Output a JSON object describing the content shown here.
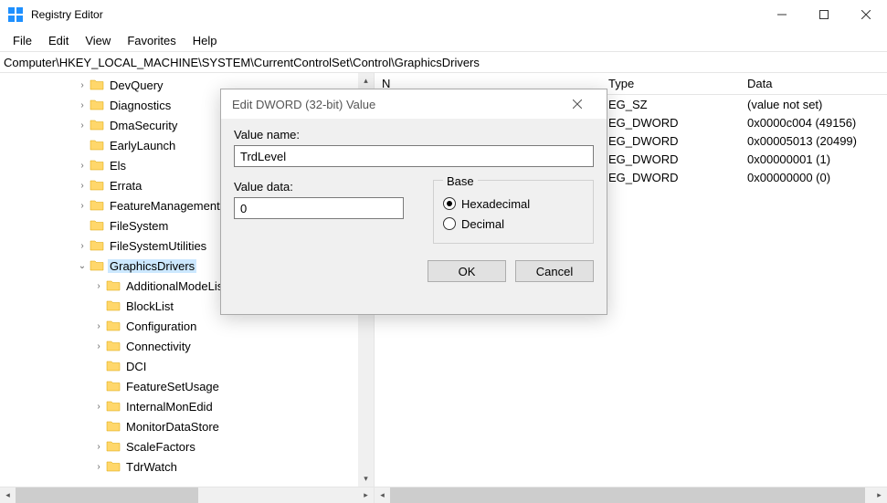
{
  "window": {
    "title": "Registry Editor",
    "menu": [
      "File",
      "Edit",
      "View",
      "Favorites",
      "Help"
    ],
    "address": "Computer\\HKEY_LOCAL_MACHINE\\SYSTEM\\CurrentControlSet\\Control\\GraphicsDrivers"
  },
  "tree": [
    {
      "label": "DevQuery",
      "depth": 3,
      "expand": "collapsed"
    },
    {
      "label": "Diagnostics",
      "depth": 3,
      "expand": "collapsed"
    },
    {
      "label": "DmaSecurity",
      "depth": 3,
      "expand": "collapsed"
    },
    {
      "label": "EarlyLaunch",
      "depth": 3,
      "expand": "none"
    },
    {
      "label": "Els",
      "depth": 3,
      "expand": "collapsed"
    },
    {
      "label": "Errata",
      "depth": 3,
      "expand": "collapsed"
    },
    {
      "label": "FeatureManagement",
      "depth": 3,
      "expand": "collapsed"
    },
    {
      "label": "FileSystem",
      "depth": 3,
      "expand": "none"
    },
    {
      "label": "FileSystemUtilities",
      "depth": 3,
      "expand": "collapsed"
    },
    {
      "label": "GraphicsDrivers",
      "depth": 3,
      "expand": "expanded",
      "selected": true
    },
    {
      "label": "AdditionalModeLis",
      "depth": 4,
      "expand": "collapsed"
    },
    {
      "label": "BlockList",
      "depth": 4,
      "expand": "none"
    },
    {
      "label": "Configuration",
      "depth": 4,
      "expand": "collapsed"
    },
    {
      "label": "Connectivity",
      "depth": 4,
      "expand": "collapsed"
    },
    {
      "label": "DCI",
      "depth": 4,
      "expand": "none"
    },
    {
      "label": "FeatureSetUsage",
      "depth": 4,
      "expand": "none"
    },
    {
      "label": "InternalMonEdid",
      "depth": 4,
      "expand": "collapsed"
    },
    {
      "label": "MonitorDataStore",
      "depth": 4,
      "expand": "none"
    },
    {
      "label": "ScaleFactors",
      "depth": 4,
      "expand": "collapsed"
    },
    {
      "label": "TdrWatch",
      "depth": 4,
      "expand": "collapsed"
    }
  ],
  "list": {
    "headers": {
      "name": "N",
      "type": "Type",
      "data": "Data"
    },
    "rows": [
      {
        "type": "EG_SZ",
        "data": "(value not set)"
      },
      {
        "type": "EG_DWORD",
        "data": "0x0000c004 (49156)"
      },
      {
        "type": "EG_DWORD",
        "data": "0x00005013 (20499)"
      },
      {
        "type": "EG_DWORD",
        "data": "0x00000001 (1)"
      },
      {
        "type": "EG_DWORD",
        "data": "0x00000000 (0)"
      }
    ]
  },
  "dialog": {
    "title": "Edit DWORD (32-bit) Value",
    "valueNameLabel": "Value name:",
    "valueName": "TrdLevel",
    "valueDataLabel": "Value data:",
    "valueData": "0",
    "baseLabel": "Base",
    "radioHex": "Hexadecimal",
    "radioDec": "Decimal",
    "baseSelected": "hex",
    "ok": "OK",
    "cancel": "Cancel"
  }
}
